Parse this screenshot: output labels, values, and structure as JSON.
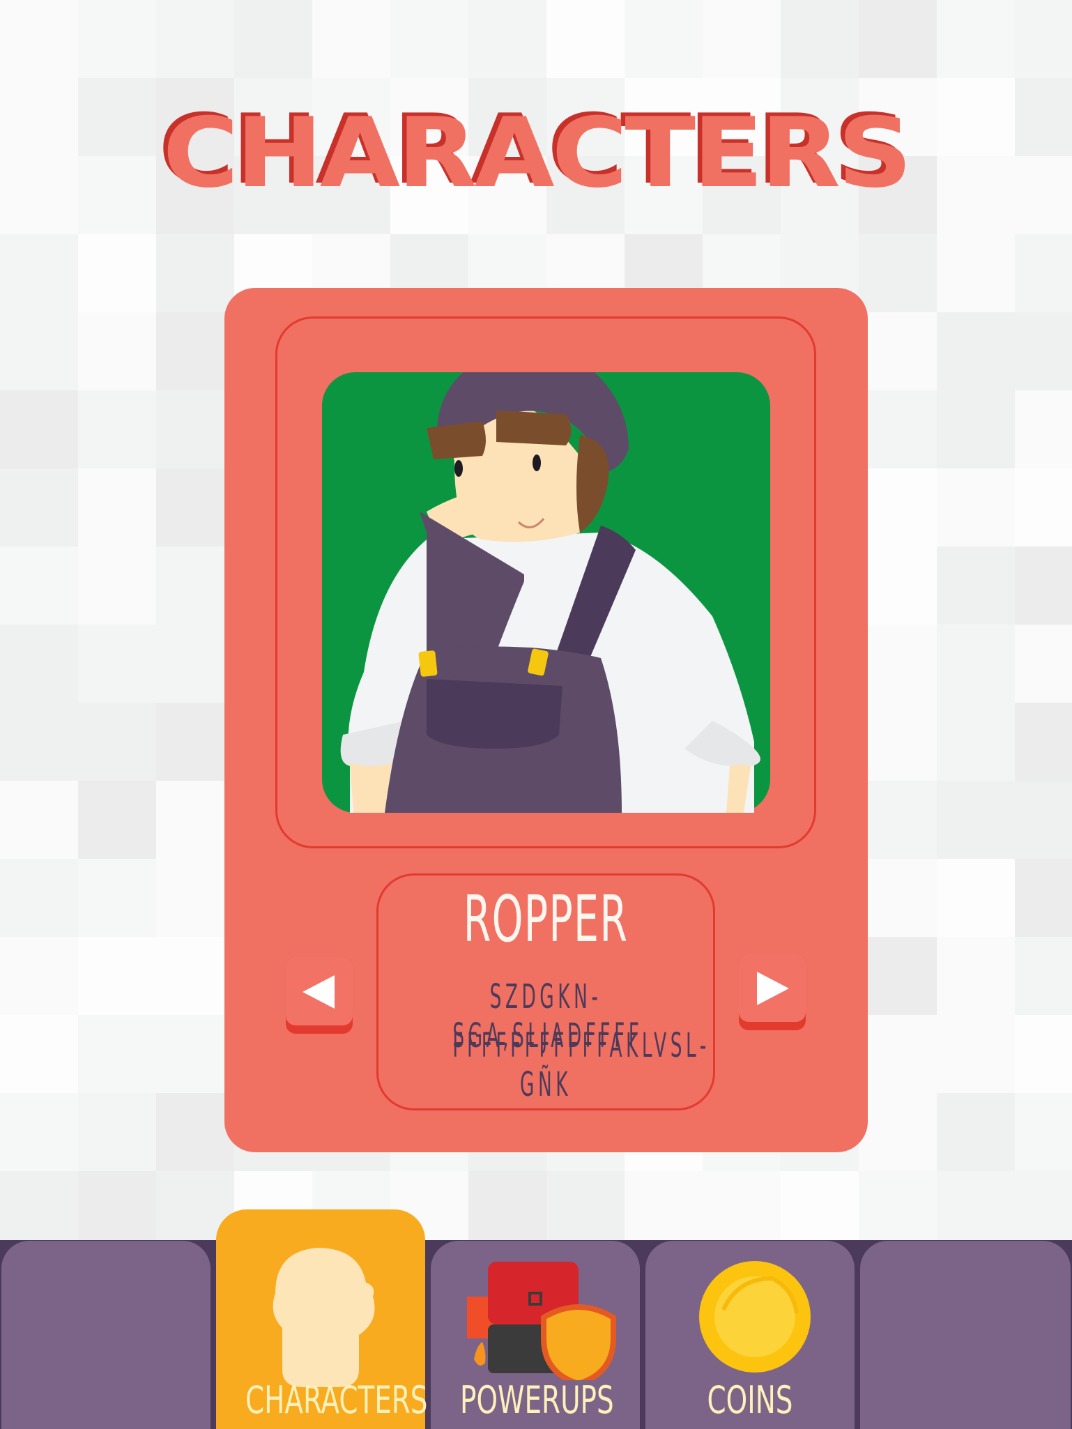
{
  "screen_title": "CHARACTERS",
  "character": {
    "name": "ROPPER",
    "description_line1": "SZDGKN-SGA,SLJADFFFF",
    "description_line2": "FFFFFFFFFFFAKLVSL-GÑK"
  },
  "nav": {
    "prev_icon": "left-arrow-icon",
    "next_icon": "right-arrow-icon"
  },
  "tabs": [
    {
      "label": "",
      "icon": ""
    },
    {
      "label": "CHARACTERS",
      "icon": "character-silhouette-icon",
      "active": true
    },
    {
      "label": "POWERUPS",
      "icon": "jetpack-shield-icon"
    },
    {
      "label": "COINS",
      "icon": "coin-icon"
    },
    {
      "label": "",
      "icon": ""
    }
  ],
  "colors": {
    "card": "#f07062",
    "card_border": "#e23b2e",
    "portrait_bg": "#0b9541",
    "tab_bar": "#7c6488",
    "tab_active": "#f8ab1e",
    "tab_text": "#fdf0bb"
  }
}
